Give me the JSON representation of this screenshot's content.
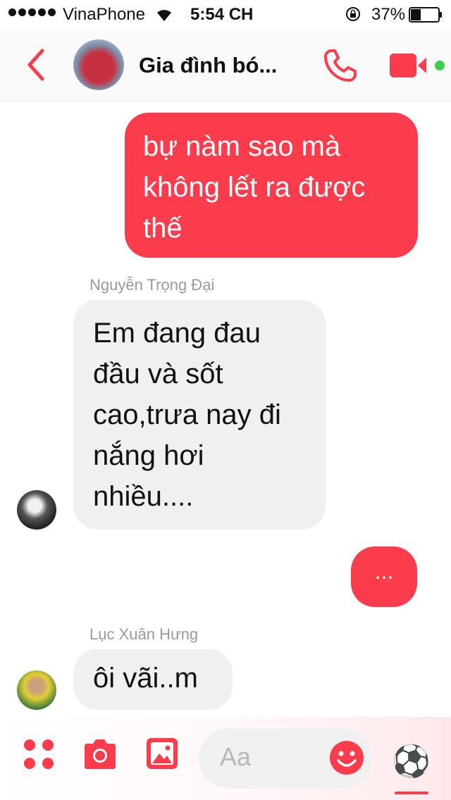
{
  "status_bar": {
    "carrier": "VinaPhone",
    "time": "5:54 CH",
    "battery": "37%",
    "battery_level": 0.37
  },
  "header": {
    "title": "Gia đình bó...",
    "back_icon": "chevron-left-icon",
    "call_icon": "phone-icon",
    "video_icon": "video-camera-icon"
  },
  "messages": [
    {
      "direction": "outgoing",
      "text": "bự nàm sao mà không lết ra được thế"
    },
    {
      "direction": "incoming",
      "sender": "Nguyễn Trọng Đại",
      "text": "Em đang đau đầu và sốt cao,trưa nay đi nắng hơi nhiều...."
    },
    {
      "direction": "outgoing",
      "text": "..."
    },
    {
      "direction": "incoming",
      "sender": "Lục Xuân Hưng",
      "text": "ôi vãi..m"
    }
  ],
  "composer": {
    "placeholder": "Aa",
    "quick_reaction": "⚽",
    "icons": [
      "apps-icon",
      "camera-icon",
      "photo-icon",
      "emoji-icon"
    ]
  },
  "colors": {
    "accent": "#fa3c4c",
    "incoming_bubble": "#f1f0f0",
    "active_status": "#3ccf4e"
  }
}
